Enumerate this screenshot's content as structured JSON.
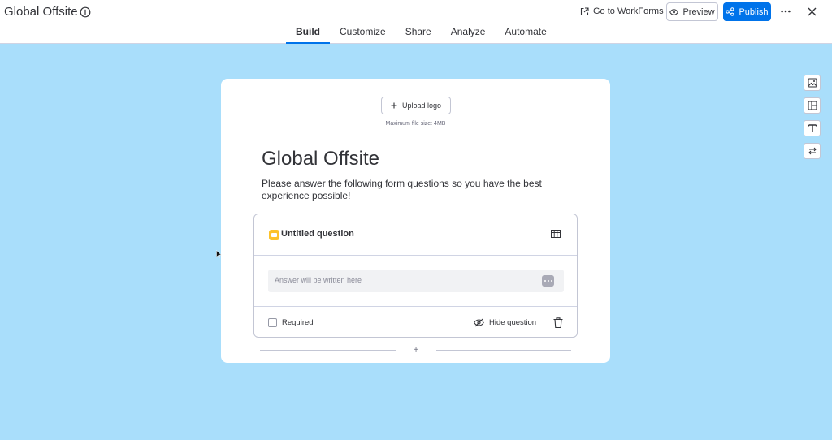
{
  "header": {
    "form_title": "Global Offsite",
    "goto_label": "Go to WorkForms",
    "preview_label": "Preview",
    "publish_label": "Publish"
  },
  "tabs": [
    {
      "label": "Build",
      "active": true
    },
    {
      "label": "Customize",
      "active": false
    },
    {
      "label": "Share",
      "active": false
    },
    {
      "label": "Analyze",
      "active": false
    },
    {
      "label": "Automate",
      "active": false
    }
  ],
  "card": {
    "upload_label": "Upload logo",
    "upload_hint": "Maximum file size: 4MB",
    "title": "Global Offsite",
    "description": "Please answer the following form questions so you have the best experience possible!"
  },
  "question": {
    "title": "Untitled question",
    "answer_placeholder": "Answer will be written here",
    "required_label": "Required",
    "required_checked": false,
    "hide_label": "Hide question"
  },
  "side_tools": [
    "image-icon",
    "layout-icon",
    "text-icon",
    "swap-icon"
  ],
  "colors": {
    "background": "#a9defb",
    "accent": "#0073ea",
    "question_icon": "#fdc22a"
  }
}
